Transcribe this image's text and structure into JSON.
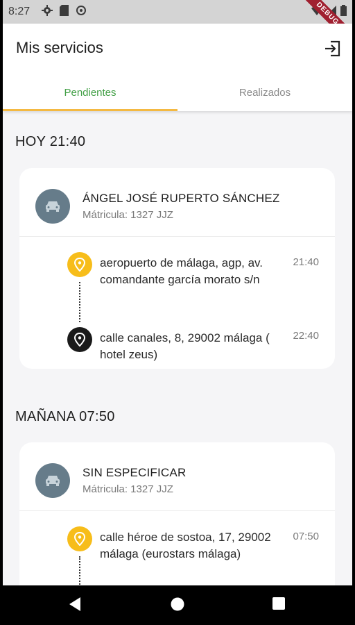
{
  "status_bar": {
    "time": "8:27",
    "debug_label": "DEBUG"
  },
  "app_bar": {
    "title": "Mis servicios"
  },
  "tabs": [
    {
      "label": "Pendientes",
      "active": true
    },
    {
      "label": "Realizados",
      "active": false
    }
  ],
  "colors": {
    "active_tab": "#43a047",
    "indicator": "#f4b942",
    "origin_pin": "#f7bd1a",
    "destination_pin": "#1a1a1a",
    "avatar": "#667c8a"
  },
  "services": [
    {
      "header": "HOY 21:40",
      "driver": "ÁNGEL JOSÉ RUPERTO SÁNCHEZ",
      "plate": "Mátricula: 1327 JJZ",
      "stops": [
        {
          "type": "origin",
          "address": "aeropuerto de málaga, agp, av. comandante garcía morato s/n",
          "time": "21:40"
        },
        {
          "type": "destination",
          "address": "calle canales, 8, 29002 málaga ( hotel zeus)",
          "time": "22:40"
        }
      ]
    },
    {
      "header": "MAÑANA 07:50",
      "driver": "SIN ESPECIFICAR",
      "plate": "Mátricula: 1327 JJZ",
      "stops": [
        {
          "type": "origin",
          "address": "calle héroe de sostoa, 17, 29002 málaga (eurostars málaga)",
          "time": "07:50"
        }
      ]
    }
  ]
}
